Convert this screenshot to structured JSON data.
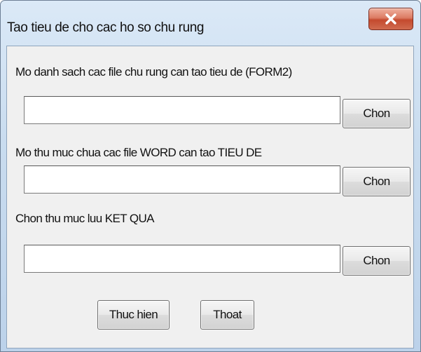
{
  "window": {
    "title": "Tao tieu de cho cac ho so chu rung",
    "close_label": "X",
    "close_icon": "close-icon",
    "close_color": "#c44a2e"
  },
  "form": {
    "field1": {
      "label": "Mo danh sach cac file chu rung can tao tieu de (FORM2)",
      "value": "",
      "button": "Chon"
    },
    "field2": {
      "label": "Mo thu muc chua cac file WORD can tao TIEU DE",
      "value": "",
      "button": "Chon"
    },
    "field3": {
      "label": "Chon thu muc luu KET QUA",
      "value": "",
      "button": "Chon"
    }
  },
  "actions": {
    "execute_label": "Thuc hien",
    "exit_label": "Thoat"
  }
}
